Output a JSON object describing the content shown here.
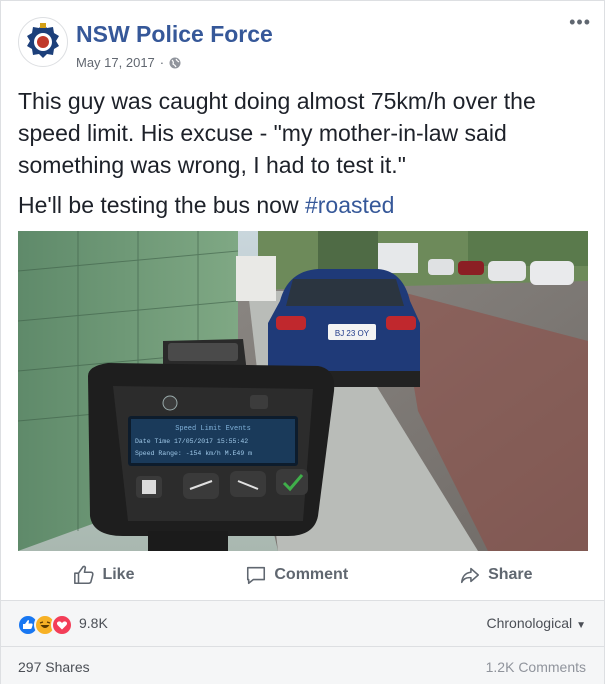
{
  "post": {
    "page_name": "NSW Police Force",
    "date": "May 17, 2017",
    "privacy_icon": "globe-icon",
    "more_icon": "more-options-icon",
    "text_line1": "This guy was caught doing almost 75km/h over the speed limit. His excuse - \"my mother-in-law said something was wrong, I had to test it.\"",
    "text_line2": "He'll be testing the bus now ",
    "hashtag": "#roasted"
  },
  "actions": {
    "like": "Like",
    "comment": "Comment",
    "share": "Share"
  },
  "reactions": {
    "count": "9.8K",
    "sort": "Chronological",
    "icons": [
      "like-reaction-icon",
      "haha-reaction-icon",
      "love-reaction-icon"
    ]
  },
  "footer": {
    "shares": "297 Shares",
    "comments": "1.2K Comments"
  },
  "photo": {
    "device_text1": "Speed Limit Events",
    "device_text2": "Date Time 17/05/2017 15:55:42",
    "device_text3": "Speed Range: -154 km/h M.E49 m",
    "plate": "BJ 23 OY"
  },
  "colors": {
    "brand": "#365899",
    "text": "#1d2129",
    "muted": "#606770"
  }
}
